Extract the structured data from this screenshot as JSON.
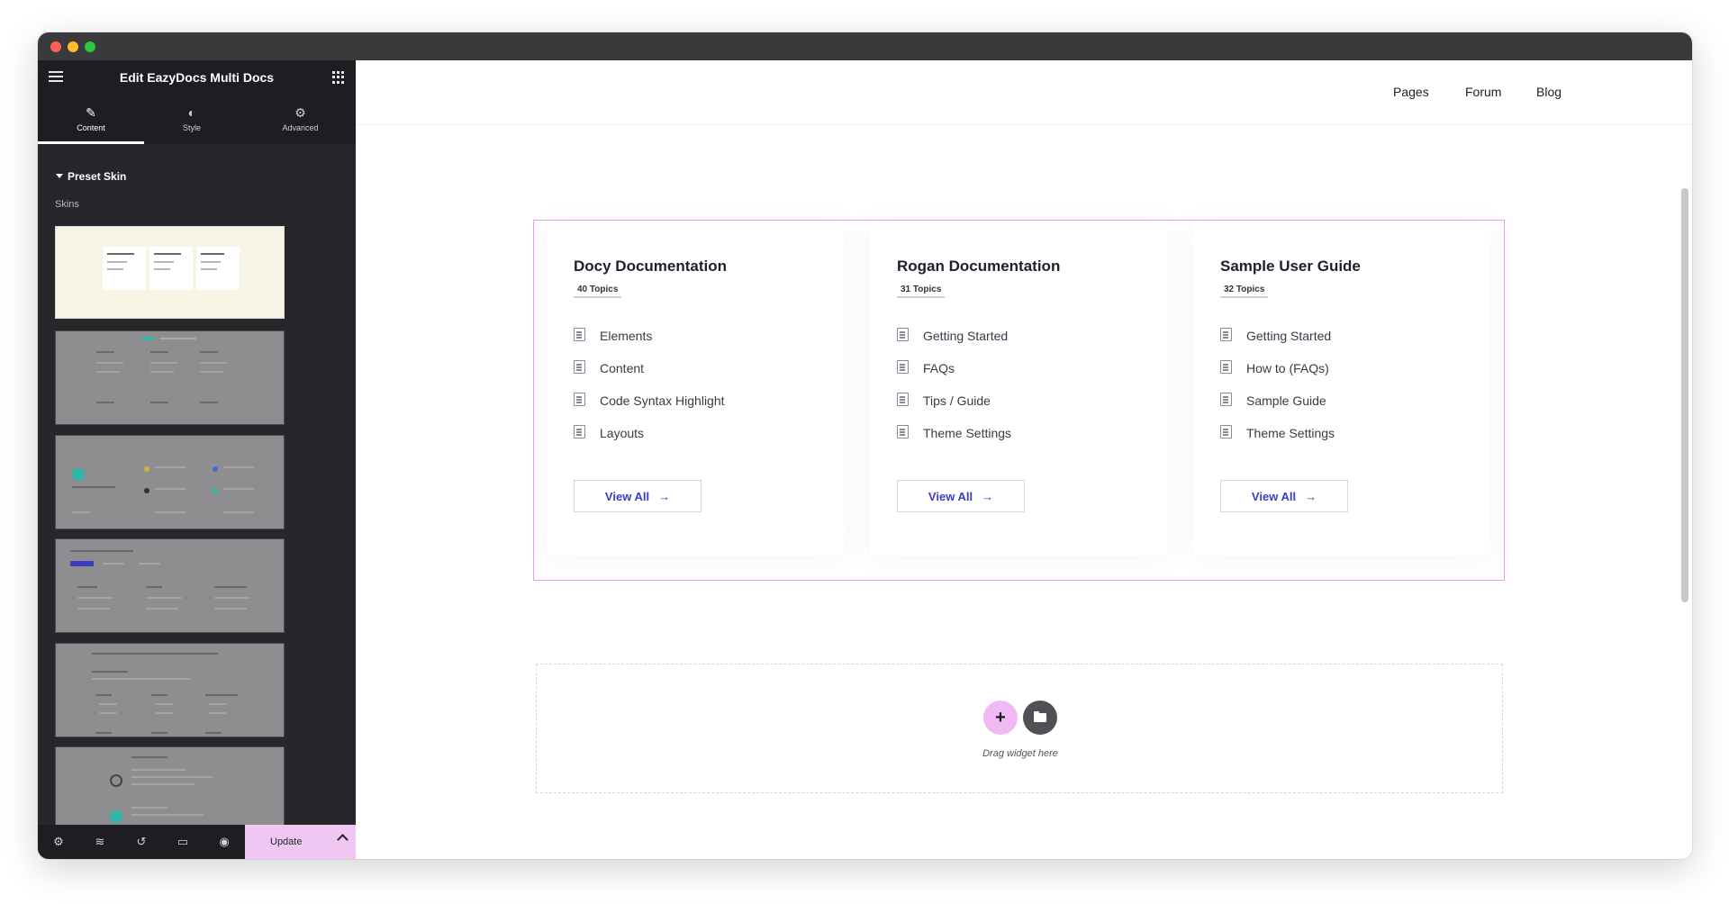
{
  "editor": {
    "title": "Edit EazyDocs Multi Docs",
    "tabs": [
      {
        "label": "Content",
        "icon": "pencil-icon",
        "active": true
      },
      {
        "label": "Style",
        "icon": "half-circle-icon",
        "active": false
      },
      {
        "label": "Advanced",
        "icon": "gear-icon",
        "active": false
      }
    ],
    "section_title": "Preset Skin",
    "skins_label": "Skins",
    "update_label": "Update"
  },
  "nav": {
    "items": [
      "Pages",
      "Forum",
      "Blog"
    ]
  },
  "docs": [
    {
      "title": "Docy Documentation",
      "badge": "40 Topics",
      "items": [
        "Elements",
        "Content",
        "Code Syntax Highlight",
        "Layouts"
      ],
      "button": "View All"
    },
    {
      "title": "Rogan Documentation",
      "badge": "31 Topics",
      "items": [
        "Getting Started",
        "FAQs",
        "Tips / Guide",
        "Theme Settings"
      ],
      "button": "View All"
    },
    {
      "title": "Sample User Guide",
      "badge": "32 Topics",
      "items": [
        "Getting Started",
        "How to (FAQs)",
        "Sample Guide",
        "Theme Settings"
      ],
      "button": "View All"
    }
  ],
  "dropzone": {
    "text": "Drag widget here"
  },
  "colors": {
    "accent_pink": "#f0b9f3",
    "section_border": "#ee9cf0",
    "link_blue": "#3b3bc4",
    "sidebar_bg": "#26262b"
  }
}
